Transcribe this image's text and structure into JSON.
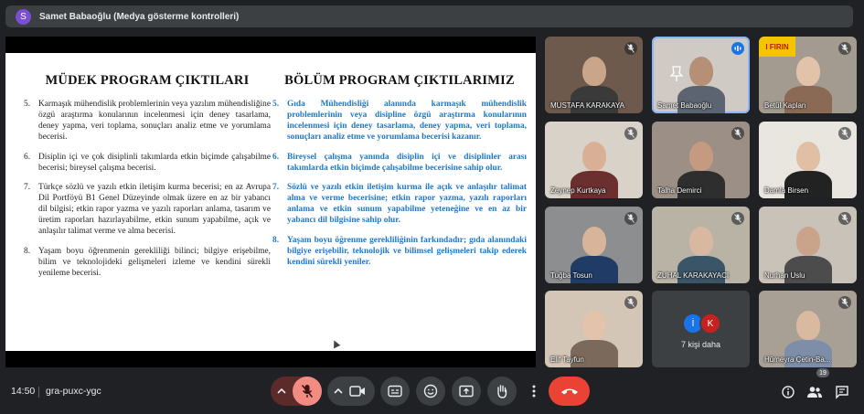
{
  "presenter": {
    "initial": "S",
    "title": "Samet Babaoğlu (Medya gösterme kontrolleri)"
  },
  "slide": {
    "left_title": "MÜDEK PROGRAM ÇIKTILARI",
    "right_title": "BÖLÜM PROGRAM ÇIKTILARIMIZ",
    "left_items": [
      {
        "num": "5.",
        "text": "Karmaşık mühendislik problemlerinin veya yazılım mühendisliğine özgü araştırma konularının incelenmesi için deney tasarlama, deney yapma, veri toplama, sonuçları analiz etme ve yorumlama becerisi."
      },
      {
        "num": "6.",
        "text": "Disiplin içi ve çok disiplinli takımlarda etkin biçimde çalışabilme becerisi; bireysel çalışma becerisi."
      },
      {
        "num": "7.",
        "text": "Türkçe sözlü ve yazılı etkin iletişim kurma becerisi; en az Avrupa Dil Portföyü B1 Genel Düzeyinde olmak üzere en az bir yabancı dil bilgisi; etkin rapor yazma ve yazılı raporları anlama, tasarım ve üretim raporları hazırlayabilme, etkin sunum yapabilme, açık ve anlaşılır talimat verme ve alma becerisi."
      },
      {
        "num": "8.",
        "text": "Yaşam boyu öğrenmenin gerekliliği bilinci; bilgiye erişebilme, bilim ve teknolojideki gelişmeleri izleme ve kendini sürekli yenileme becerisi."
      }
    ],
    "right_items": [
      {
        "num": "5.",
        "text": "Gıda Mühendisliği alanında karmaşık mühendislik problemlerinin veya disipline özgü araştırma konularının incelenmesi için deney tasarlama, deney yapma, veri toplama, sonuçları analiz etme ve yorumlama becerisi kazanır."
      },
      {
        "num": "6.",
        "text": "Bireysel çalışma yanında disiplin içi ve disiplinler arası takımlarda etkin biçimde çalışabilme becerisine sahip olur."
      },
      {
        "num": "7.",
        "text": "Sözlü ve yazılı etkin iletişim kurma ile açık ve anlaşılır talimat alma ve verme becerisine; etkin rapor yazma, yazılı raporları anlama ve etkin sunum yapabilme yeteneğine ve en az bir yabancı dil bilgisine sahip olur."
      },
      {
        "num": "8.",
        "text": "Yaşam boyu öğrenme gerekliliğinin farkındadır; gıda alanındaki bilgiye erişebilir, teknolojik ve bilimsel gelişmeleri takip ederek kendini sürekli yeniler."
      }
    ]
  },
  "participants": [
    {
      "name": "MUSTAFA KARAKAYA",
      "muted": true,
      "bg": "#6d5a4d",
      "skin": "#c9a58a",
      "cloth": "#3a3a3a"
    },
    {
      "name": "Samet Babaoğlu",
      "muted": false,
      "speaking": true,
      "active": true,
      "bg": "#cfcac3",
      "skin": "#b58f76",
      "cloth": "#5b6470"
    },
    {
      "name": "Betül Kaplan",
      "muted": true,
      "bg": "#a39a90",
      "skin": "#e2c2a8",
      "cloth": "#8a6a55",
      "banner": "I FIRIN"
    },
    {
      "name": "Zeynep Kurtkaya",
      "muted": true,
      "bg": "#d8d2c8",
      "skin": "#d9b096",
      "cloth": "#6b2f2f"
    },
    {
      "name": "Talha Demirci",
      "muted": true,
      "bg": "#9c8f85",
      "skin": "#c49a80",
      "cloth": "#2e2e2e"
    },
    {
      "name": "Damla Birsen",
      "muted": true,
      "bg": "#e9e5df",
      "skin": "#e0bfa5",
      "cloth": "#222222"
    },
    {
      "name": "Tuğba Tosun",
      "muted": true,
      "bg": "#8c8e90",
      "skin": "#d8b49a",
      "cloth": "#1f3b66"
    },
    {
      "name": "ZUHAL KARAKAYACI",
      "muted": true,
      "bg": "#b9b3a6",
      "skin": "#d8b8a0",
      "cloth": "#3b5568"
    },
    {
      "name": "Nurhan Uslu",
      "muted": true,
      "bg": "#c8c2b8",
      "skin": "#c9a48a",
      "cloth": "#4c4c4c"
    },
    {
      "name": "Elif Tayfun",
      "muted": true,
      "bg": "#d4c6b6",
      "skin": "#e3c4aa",
      "cloth": "#7b6a5c"
    },
    {
      "name": "Hümeyra Çetin-Ba...",
      "muted": true,
      "bg": "#a89f95",
      "skin": "#d9b9a0",
      "cloth": "#7e8ea8"
    }
  ],
  "more": {
    "label": "7 kişi daha",
    "avatars": [
      {
        "letter": "İ",
        "color": "#1a73e8"
      },
      {
        "letter": "K",
        "color": "#c5221f"
      }
    ]
  },
  "bottom": {
    "time": "14:50",
    "code": "gra-puxc-ygc",
    "people_count": "19"
  },
  "colors": {
    "accent": "#8ab4f8",
    "end_call": "#ea4335",
    "mic_off_bg": "#f28b82"
  }
}
